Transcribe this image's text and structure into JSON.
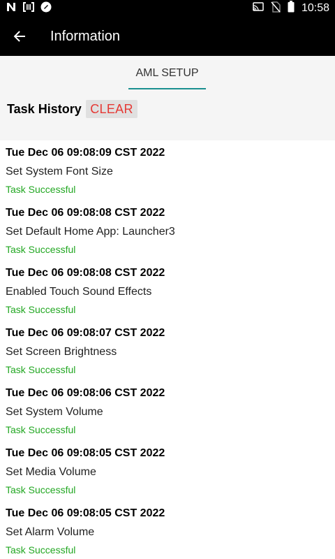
{
  "status_bar": {
    "time": "10:58",
    "icons": [
      "n-icon",
      "barcode-scanner-icon",
      "app-circle-icon",
      "cast-icon",
      "no-sim-icon",
      "battery-icon"
    ]
  },
  "app_bar": {
    "title": "Information",
    "back_icon": "arrow-back-icon"
  },
  "tabs": [
    {
      "label": "AML SETUP",
      "selected": true
    }
  ],
  "task_history": {
    "label": "Task History",
    "clear_label": "CLEAR"
  },
  "colors": {
    "tab_underline": "#1a8f8f",
    "clear_text": "#e53935",
    "success_text": "#22a722"
  },
  "tasks": [
    {
      "time": "Tue Dec 06 09:08:09 CST 2022",
      "name": "Set System Font Size",
      "status": "Task Successful"
    },
    {
      "time": "Tue Dec 06 09:08:08 CST 2022",
      "name": "Set Default Home App: Launcher3",
      "status": "Task Successful"
    },
    {
      "time": "Tue Dec 06 09:08:08 CST 2022",
      "name": "Enabled Touch Sound Effects",
      "status": "Task Successful"
    },
    {
      "time": "Tue Dec 06 09:08:07 CST 2022",
      "name": "Set Screen Brightness",
      "status": "Task Successful"
    },
    {
      "time": "Tue Dec 06 09:08:06 CST 2022",
      "name": "Set System Volume",
      "status": "Task Successful"
    },
    {
      "time": "Tue Dec 06 09:08:05 CST 2022",
      "name": "Set Media Volume",
      "status": "Task Successful"
    },
    {
      "time": "Tue Dec 06 09:08:05 CST 2022",
      "name": "Set Alarm Volume",
      "status": "Task Successful"
    }
  ]
}
